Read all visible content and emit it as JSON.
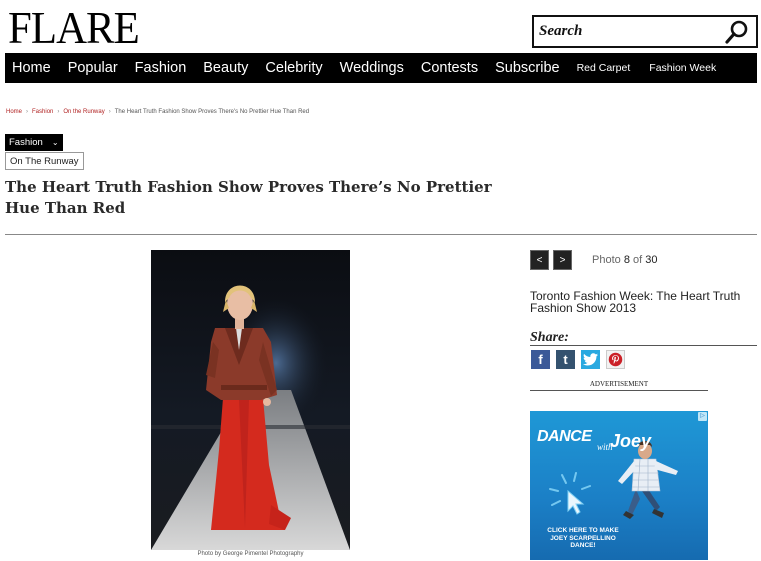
{
  "site": {
    "logo": "FLARE"
  },
  "search": {
    "placeholder": "Search"
  },
  "nav": {
    "main": [
      "Home",
      "Popular",
      "Fashion",
      "Beauty",
      "Celebrity",
      "Weddings",
      "Contests",
      "Subscribe"
    ],
    "secondary": [
      "Red Carpet",
      "Fashion Week"
    ]
  },
  "breadcrumb": {
    "home": "Home",
    "fashion": "Fashion",
    "runway": "On the Runway",
    "current": "The Heart Truth Fashion Show Proves There's No Prettier Hue Than Red",
    "separator": "›"
  },
  "category": {
    "selected": "Fashion",
    "chevron": "⌄",
    "sub": "On The Runway"
  },
  "article": {
    "title": "The Heart Truth Fashion Show Proves There’s No Prettier Hue Than Red",
    "photo_caption": "Photo by George Pimentel Photography"
  },
  "gallery": {
    "prev": "<",
    "next": ">",
    "photo_word": "Photo",
    "current": "8",
    "of_word": "of",
    "total": "30",
    "title": "Toronto Fashion Week: The Heart Truth Fashion Show 2013"
  },
  "share": {
    "label": "Share:",
    "icons": [
      {
        "name": "facebook-icon",
        "glyph": "f",
        "color": "#3b5998"
      },
      {
        "name": "tumblr-icon",
        "glyph": "t",
        "color": "#34526f"
      },
      {
        "name": "twitter-icon",
        "glyph": "t",
        "color": "#2aa9e0"
      },
      {
        "name": "pinterest-icon",
        "glyph": "P",
        "color": "#cb2027"
      }
    ]
  },
  "ad": {
    "label": "ADVERTISEMENT",
    "dance": "DANCE",
    "with": "with",
    "joey": "Joey",
    "cta": "CLICK HERE TO MAKE JOEY SCARPELLINO DANCE!",
    "choice_glyph": "▷"
  },
  "colors": {
    "nav_bg": "#000000",
    "breadcrumb_link": "#b02020",
    "ad_bg": "#1b7fc6",
    "dress_red": "#d42a1e"
  }
}
